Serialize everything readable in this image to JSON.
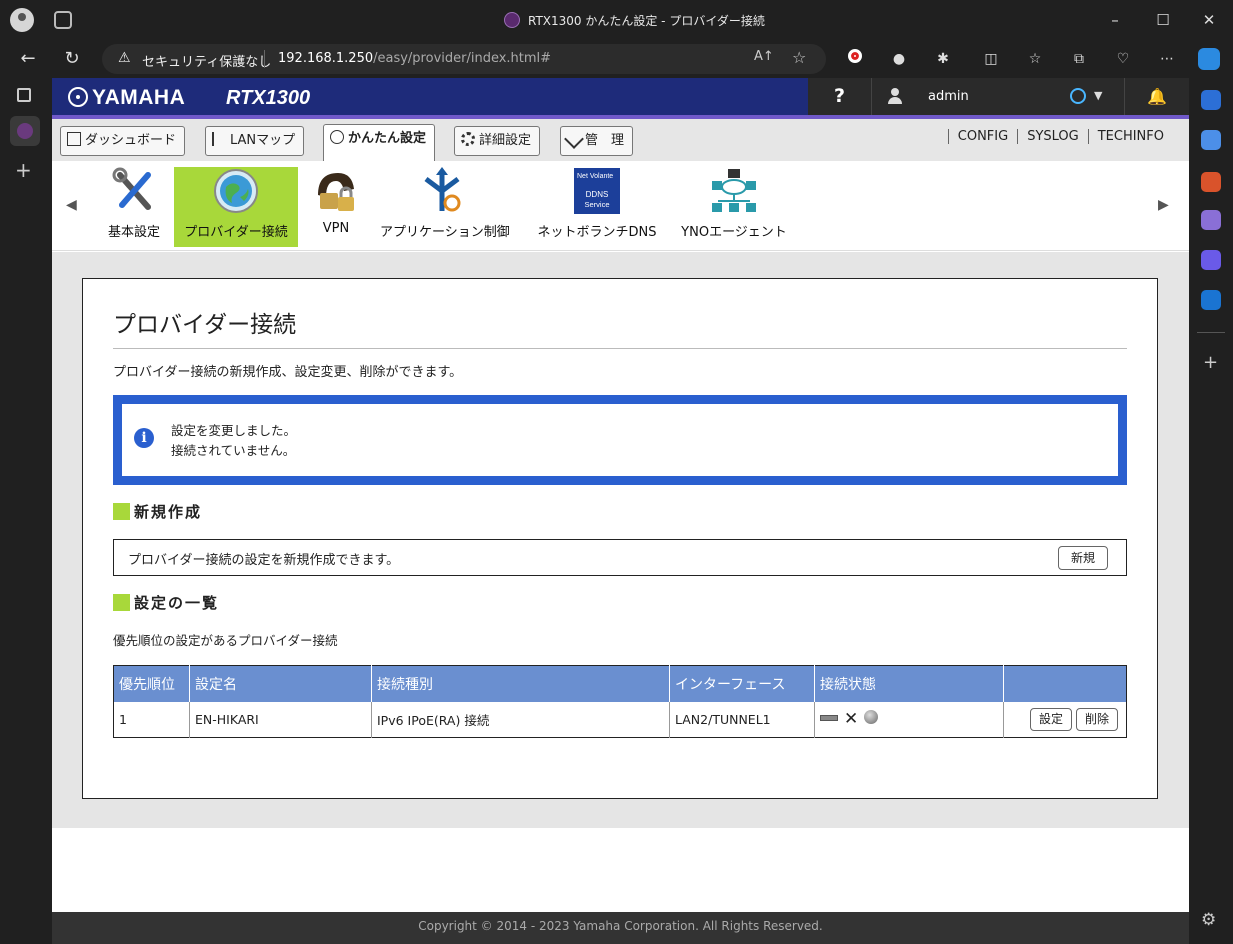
{
  "browser": {
    "tab_title": "RTX1300 かんたん設定 - プロバイダー接続",
    "security_label": "セキュリティ保護なし",
    "url_host": "192.168.1.250",
    "url_path": "/easy/provider/index.html#",
    "read_aloud": "A↑",
    "window_controls": [
      "–",
      "☐",
      "✕"
    ]
  },
  "header": {
    "brand": "YAMAHA",
    "model": "RTX1300",
    "help": "?",
    "user": "admin"
  },
  "menu": {
    "tabs": [
      {
        "label": "ダッシュボード",
        "icon": "dashboard-icon"
      },
      {
        "label": "LANマップ",
        "icon": "lanmap-icon"
      },
      {
        "label": "かんたん設定",
        "icon": "wizard-icon",
        "active": true
      },
      {
        "label": "詳細設定",
        "icon": "gear-icon"
      },
      {
        "label": "管　理",
        "icon": "wrench-icon"
      }
    ],
    "utilities": [
      "CONFIG",
      "SYSLOG",
      "TECHINFO"
    ]
  },
  "icons": [
    {
      "label": "基本設定",
      "icon": "tools-icon"
    },
    {
      "label": "プロバイダー接続",
      "icon": "globe-icon",
      "selected": true
    },
    {
      "label": "VPN",
      "icon": "vpn-lock-icon"
    },
    {
      "label": "アプリケーション制御",
      "icon": "app-control-icon"
    },
    {
      "label": "ネットボランチDNS",
      "icon": "ddns-icon",
      "art_text": "Net Volante DDNS Service"
    },
    {
      "label": "YNOエージェント",
      "icon": "yno-agent-icon"
    }
  ],
  "main": {
    "title": "プロバイダー接続",
    "description": "プロバイダー接続の新規作成、設定変更、削除ができます。",
    "notice": {
      "line1": "設定を変更しました。",
      "line2": "接続されていません。"
    },
    "new_section": {
      "heading": "新規作成",
      "text": "プロバイダー接続の設定を新規作成できます。",
      "button": "新規"
    },
    "list_section": {
      "heading": "設定の一覧",
      "subtitle": "優先順位の設定があるプロバイダー接続",
      "columns": [
        "優先順位",
        "設定名",
        "接続種別",
        "インターフェース",
        "接続状態",
        ""
      ],
      "rows": [
        {
          "priority": "1",
          "name": "EN-HIKARI",
          "type": "IPv6 IPoE(RA) 接続",
          "interface": "LAN2/TUNNEL1",
          "edit": "設定",
          "delete": "削除"
        }
      ]
    }
  },
  "footer": "Copyright © 2014 - 2023 Yamaha Corporation. All Rights Reserved.",
  "colors": {
    "header_bg": "#1e2b7a",
    "accent_green": "#a8d83a",
    "notice_blue": "#2a5fcf",
    "table_header": "#6a8fd0"
  }
}
